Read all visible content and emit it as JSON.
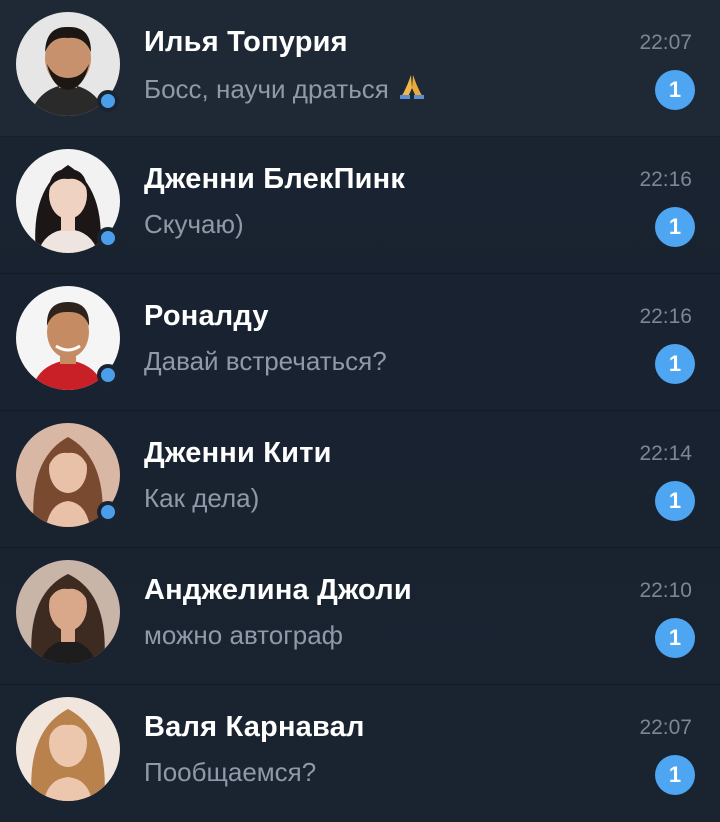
{
  "chats": [
    {
      "name": "Илья Топурия",
      "preview": "Босс, научи драться",
      "preview_emoji": "pray-icon",
      "time": "22:07",
      "unread": "1",
      "avatar_skin": "#c7916d",
      "avatar_hair": "#1d1714",
      "avatar_bg": "#e6e6e6",
      "avatar_shirt": "#2a2a2a"
    },
    {
      "name": "Дженни БлекПинк",
      "preview": "Скучаю)",
      "time": "22:16",
      "unread": "1",
      "avatar_skin": "#efd2c2",
      "avatar_hair": "#1c1616",
      "avatar_bg": "#f2f2f2",
      "avatar_shirt": "#efe5e0"
    },
    {
      "name": "Роналду",
      "preview": "Давай встречаться?",
      "time": "22:16",
      "unread": "1",
      "avatar_skin": "#c58b62",
      "avatar_hair": "#2d231c",
      "avatar_bg": "#f5f5f5",
      "avatar_shirt": "#c91f27"
    },
    {
      "name": "Дженни Кити",
      "preview": "Как дела)",
      "time": "22:14",
      "unread": "1",
      "avatar_skin": "#e9c0a8",
      "avatar_hair": "#7a4a30",
      "avatar_bg": "#d8b7a5",
      "avatar_shirt": "#e9c0a8"
    },
    {
      "name": "Анджелина Джоли",
      "preview": "можно автограф",
      "time": "22:10",
      "unread": "1",
      "avatar_skin": "#d9a78a",
      "avatar_hair": "#3d2b22",
      "avatar_bg": "#c9b4a8",
      "avatar_shirt": "#1d1d1d"
    },
    {
      "name": "Валя Карнавал",
      "preview": "Пообщаемся?",
      "time": "22:07",
      "unread": "1",
      "avatar_skin": "#edc7ad",
      "avatar_hair": "#b9814b",
      "avatar_bg": "#f0e6de",
      "avatar_shirt": "#edc7ad"
    }
  ],
  "colors": {
    "accent": "#4ea6f3",
    "background": "#1a2430",
    "name": "#ffffff",
    "preview": "#8e9aa8",
    "time": "#7b8794"
  }
}
